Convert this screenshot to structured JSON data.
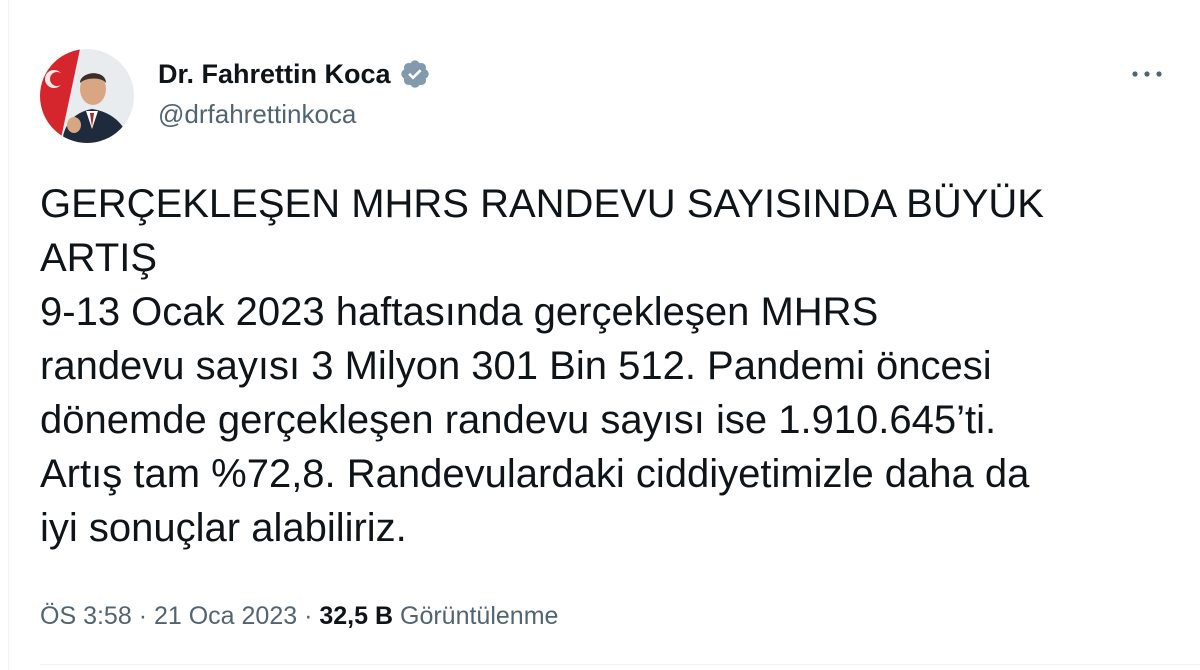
{
  "author": {
    "display_name": "Dr. Fahrettin Koca",
    "handle": "@drfahrettinkoca",
    "verified_icon": "verified-badge-icon"
  },
  "more_icon": "more-horizontal-icon",
  "tweet": {
    "lines": [
      "GERÇEKLEŞEN MHRS RANDEVU SAYISINDA BÜYÜK",
      "ARTIŞ",
      "9-13 Ocak 2023 haftasında gerçekleşen MHRS",
      "randevu sayısı 3 Milyon 301 Bin 512. Pandemi öncesi",
      "dönemde gerçekleşen randevu sayısı ise 1.910.645’ti.",
      "Artış tam %72,8. Randevulardaki ciddiyetimizle daha da",
      "iyi sonuçlar alabiliriz."
    ]
  },
  "meta": {
    "time": "ÖS 3:58",
    "separator": "·",
    "date": "21 Oca 2023",
    "views_count": "32,5 B",
    "views_label": "Görüntülenme"
  },
  "colors": {
    "text_primary": "#0f1419",
    "text_secondary": "#536471",
    "verified": "#829aab"
  }
}
